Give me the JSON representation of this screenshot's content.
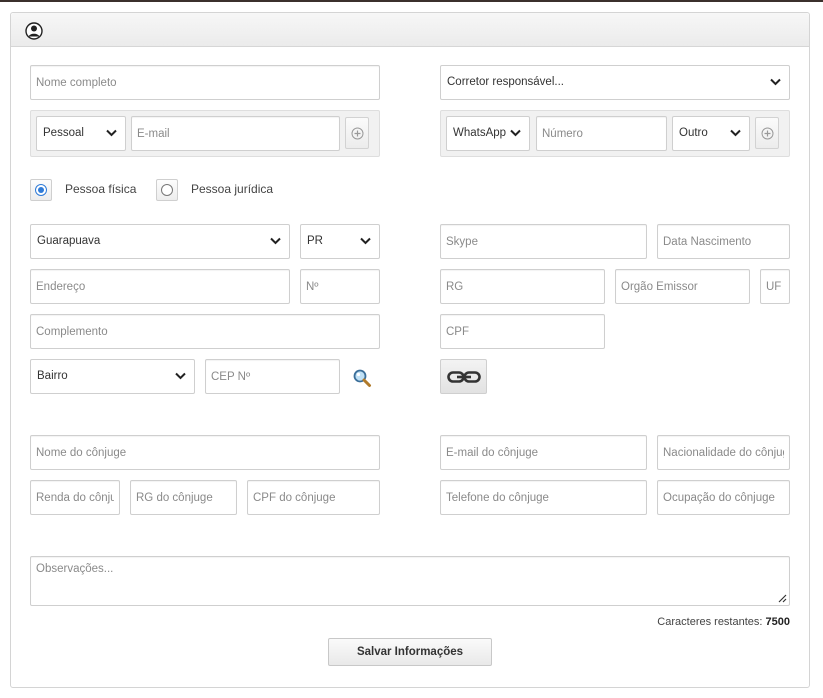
{
  "form": {
    "full_name_placeholder": "Nome completo",
    "broker_select": "Corretor responsável...",
    "email_type_select": "Pessoal",
    "email_placeholder": "E-mail",
    "phone_type_select": "WhatsApp",
    "phone_number_placeholder": "Número",
    "phone_kind_select": "Outro",
    "person_type": {
      "physical_label": "Pessoa física",
      "legal_label": "Pessoa jurídica",
      "selected": "physical"
    },
    "city_select": "Guarapuava",
    "state_select": "PR",
    "skype_placeholder": "Skype",
    "birth_date_placeholder": "Data Nascimento",
    "address_placeholder": "Endereço",
    "number_placeholder": "Nº",
    "rg_placeholder": "RG",
    "issuer_placeholder": "Órgão Emissor",
    "uf_placeholder": "UF",
    "complement_placeholder": "Complemento",
    "cpf_placeholder": "CPF",
    "neighborhood_select": "Bairro",
    "cep_placeholder": "CEP Nº",
    "spouse_name_placeholder": "Nome do cônjuge",
    "spouse_email_placeholder": "E-mail do cônjuge",
    "spouse_nationality_placeholder": "Nacionalidade do cônjuge",
    "spouse_income_placeholder": "Renda do cônjuge",
    "spouse_rg_placeholder": "RG do cônjuge",
    "spouse_cpf_placeholder": "CPF do cônjuge",
    "spouse_phone_placeholder": "Telefone do cônjuge",
    "spouse_occupation_placeholder": "Ocupação do cônjuge",
    "notes_placeholder": "Observações...",
    "remaining_label": "Caracteres restantes:",
    "remaining_count": "7500",
    "save_label": "Salvar Informações"
  },
  "icons": {
    "header": "user-icon",
    "add": "plus-circle-icon",
    "search": "magnifier-icon",
    "link": "chain-link-icon",
    "dropdown": "chevron-down-icon"
  },
  "colors": {
    "radio_accent": "#2f7bd8",
    "header_bg": "#ebebeb",
    "border": "#cfcfcf"
  }
}
